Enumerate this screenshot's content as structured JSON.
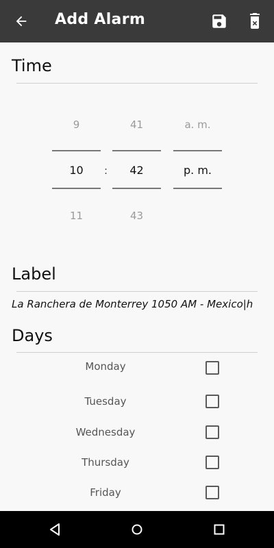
{
  "appbar": {
    "title": "Add Alarm",
    "back_icon": "arrow-left-icon",
    "save_icon": "save-icon",
    "delete_icon": "delete-icon"
  },
  "time_section": {
    "title": "Time",
    "hour": {
      "prev": "9",
      "selected": "10",
      "next": "11"
    },
    "separator": ":",
    "minute": {
      "prev": "41",
      "selected": "42",
      "next": "43"
    },
    "period": {
      "prev": "a. m.",
      "selected": "p. m."
    }
  },
  "label_section": {
    "title": "Label",
    "value": "La Ranchera de Monterrey 1050 AM - Mexico|h"
  },
  "days_section": {
    "title": "Days",
    "days": [
      {
        "name": "Monday",
        "checked": false
      },
      {
        "name": "Tuesday",
        "checked": false
      },
      {
        "name": "Wednesday",
        "checked": false
      },
      {
        "name": "Thursday",
        "checked": false
      },
      {
        "name": "Friday",
        "checked": false
      }
    ]
  },
  "navbar": {
    "back_icon": "nav-back-icon",
    "home_icon": "nav-home-icon",
    "recents_icon": "nav-recents-icon"
  }
}
